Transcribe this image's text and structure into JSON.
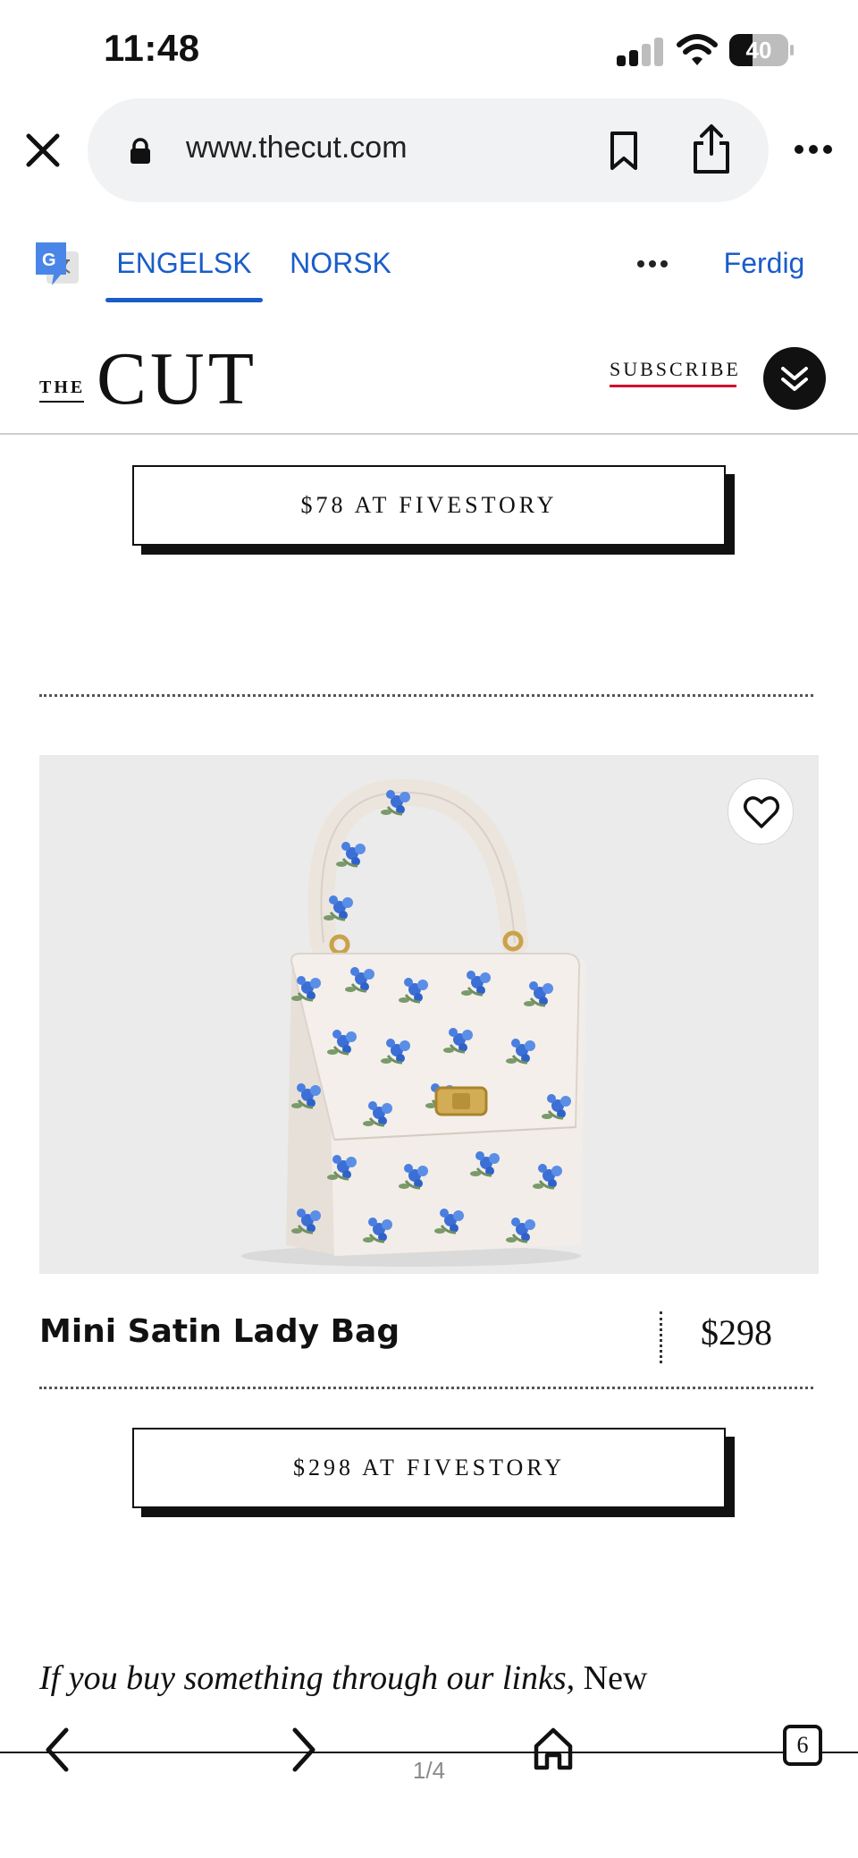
{
  "status_bar": {
    "time": "11:48",
    "battery_percent": 40,
    "battery_label": "40"
  },
  "browser": {
    "url": "www.thecut.com"
  },
  "translate_bar": {
    "tab_source": "ENGELSK",
    "tab_target": "NORSK",
    "done_label": "Ferdig"
  },
  "site_header": {
    "logo_prefix": "THE",
    "logo_main": "CUT",
    "subscribe_label": "SUBSCRIBE"
  },
  "content": {
    "prev_cta_label": "$78 AT FIVESTORY",
    "product": {
      "name": "Mini Satin Lady Bag",
      "price": "$298",
      "cta_label": "$298 AT FIVESTORY",
      "image_icon": "floral-handbag-image"
    },
    "disclaimer_italic": "If you buy something through our links,",
    "disclaimer_rest": " New"
  },
  "toolbar": {
    "tab_count": "6",
    "page_indicator": "1/4"
  },
  "colors": {
    "accent_blue": "#1a5dc9",
    "subscribe_underline": "#d4102f",
    "image_background": "#ebebeb"
  }
}
